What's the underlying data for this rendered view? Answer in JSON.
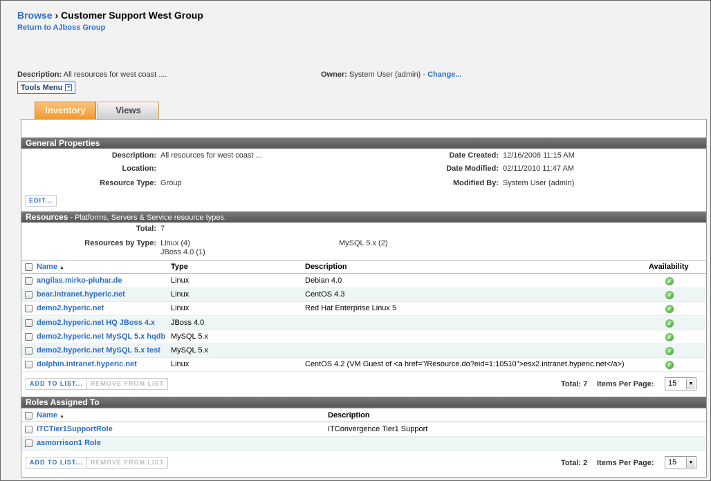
{
  "header": {
    "breadcrumb_root": "Browse",
    "separator": "›",
    "group_name": "Customer Support West Group",
    "return_link": "Return to AJboss Group"
  },
  "summary": {
    "description_label": "Description:",
    "description_value": "All resources for west coast ....",
    "owner_label": "Owner:",
    "owner_value": "System User (admin) -",
    "change_link": "Change..."
  },
  "tools_menu": {
    "label": "Tools Menu",
    "icon": "chevron-down-icon"
  },
  "tabs": [
    {
      "label": "Inventory",
      "active": true
    },
    {
      "label": "Views",
      "active": false
    }
  ],
  "general": {
    "title": "General Properties",
    "description_label": "Description:",
    "description_value": "All resources for west coast ...",
    "location_label": "Location:",
    "location_value": "",
    "type_label": "Resource Type:",
    "type_value": "Group",
    "created_label": "Date Created:",
    "created_value": "12/16/2008 11:15 AM",
    "modified_label": "Date Modified:",
    "modified_value": "02/11/2010 11:47 AM",
    "modified_by_label": "Modified By:",
    "modified_by_value": "System User (admin)",
    "edit_button": "EDIT..."
  },
  "resources": {
    "title": "Resources",
    "subtitle": " - Platforms, Servers & Service resource types.",
    "total_label": "Total:",
    "total_value": "7",
    "by_type_label": "Resources by Type:",
    "by_type": [
      "Linux (4)",
      "JBoss 4.0 (1)",
      "MySQL 5.x (2)"
    ],
    "columns": {
      "name": "Name",
      "type": "Type",
      "description": "Description",
      "availability": "Availability"
    },
    "rows": [
      {
        "name": "angilas.mirko-pluhar.de",
        "type": "Linux",
        "description": "Debian 4.0"
      },
      {
        "name": "bear.intranet.hyperic.net",
        "type": "Linux",
        "description": "CentOS 4.3"
      },
      {
        "name": "demo2.hyperic.net",
        "type": "Linux",
        "description": "Red Hat Enterprise Linux 5"
      },
      {
        "name": "demo2.hyperic.net HQ JBoss 4.x",
        "type": "JBoss 4.0",
        "description": ""
      },
      {
        "name": "demo2.hyperic.net MySQL 5.x hqdb",
        "type": "MySQL 5.x",
        "description": ""
      },
      {
        "name": "demo2.hyperic.net MySQL 5.x test",
        "type": "MySQL 5.x",
        "description": ""
      },
      {
        "name": "dolphin.intranet.hyperic.net",
        "type": "Linux",
        "description": "CentOS 4.2 (VM Guest of <a href=\"/Resource.do?eid=1:10510\">esx2.intranet.hyperic.net</a>)"
      }
    ],
    "add_button": "ADD TO LIST...",
    "remove_button": "REMOVE FROM LIST",
    "footer_total": "Total: 7",
    "items_per_page_label": "Items Per Page:",
    "items_per_page": "15"
  },
  "roles": {
    "title": "Roles Assigned To",
    "columns": {
      "name": "Name",
      "description": "Description"
    },
    "rows": [
      {
        "name": "ITCTier1SupportRole",
        "description": "ITConvergence Tier1 Support"
      },
      {
        "name": "asmorrison1 Role",
        "description": ""
      }
    ],
    "add_button": "ADD TO LIST...",
    "remove_button": "REMOVE FROM LIST",
    "footer_total": "Total: 2",
    "items_per_page_label": "Items Per Page:",
    "items_per_page": "15"
  },
  "icons": {
    "availability": "green-check-icon",
    "sort": "sort-ascending-icon",
    "dropdown": "chevron-down-icon"
  },
  "colors": {
    "link": "#2d6ec7",
    "active_tab": "#f29a2e",
    "section_header": "#666666",
    "availability_ok": "#3b9a2b"
  }
}
